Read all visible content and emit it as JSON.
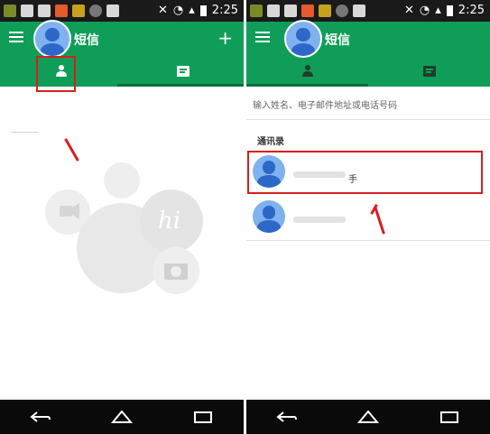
{
  "status_bar": {
    "time": "2:25"
  },
  "left_screen": {
    "title": "短信",
    "add_symbol": "+",
    "empty_illustration_text": "hi"
  },
  "right_screen": {
    "title": "短信",
    "search_placeholder": "输入姓名、电子邮件地址或电话号码",
    "section_title": "通讯录",
    "contacts": [
      {
        "name_suffix": "手"
      },
      {
        "name_suffix": ""
      }
    ]
  },
  "colors": {
    "appbar": "#0f9d58",
    "status_bar": "#1a1a1a",
    "nav_bar": "#0a0a0a",
    "highlight": "#d81e1e",
    "avatar_light": "#7fb2ee",
    "avatar_dark": "#2d68c9"
  }
}
